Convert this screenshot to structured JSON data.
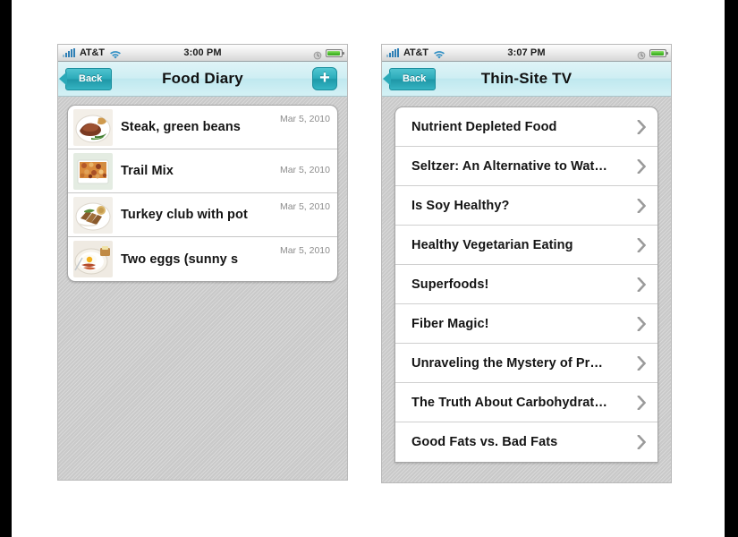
{
  "layout": {
    "background": "#ffffff",
    "letterbox_color": "#000000"
  },
  "phones": [
    {
      "id": "food-diary",
      "status_bar": {
        "carrier": "AT&T",
        "time": "3:00 PM",
        "signal_icon": "signal-bars-icon",
        "wifi_icon": "wifi-icon",
        "alarm_icon": "alarm-clock-icon",
        "battery_icon": "battery-icon"
      },
      "nav": {
        "back_label": "Back",
        "title": "Food Diary",
        "add_label": "+",
        "accent": "#2aa9b8",
        "bar_background": "#cfeef3"
      },
      "rows": [
        {
          "title": "Steak, green beans",
          "date": "Mar 5, 2010",
          "thumb": "steak-green-beans-thumbnail"
        },
        {
          "title": "Trail Mix",
          "date": "Mar 5, 2010",
          "thumb": "trail-mix-thumbnail"
        },
        {
          "title": "Turkey club with pot",
          "date": "Mar 5, 2010",
          "thumb": "turkey-club-thumbnail"
        },
        {
          "title": "Two eggs (sunny s",
          "date": "Mar 5, 2010",
          "thumb": "two-eggs-thumbnail"
        }
      ]
    },
    {
      "id": "thin-site-tv",
      "status_bar": {
        "carrier": "AT&T",
        "time": "3:07 PM",
        "signal_icon": "signal-bars-icon",
        "wifi_icon": "wifi-icon",
        "alarm_icon": "alarm-clock-icon",
        "battery_icon": "battery-icon"
      },
      "nav": {
        "back_label": "Back",
        "title": "Thin-Site TV",
        "accent": "#2aa9b8",
        "bar_background": "#cfeef3"
      },
      "rows": [
        {
          "title": "Nutrient Depleted Food"
        },
        {
          "title": "Seltzer: An Alternative to Wat…"
        },
        {
          "title": "Is Soy Healthy?"
        },
        {
          "title": "Healthy Vegetarian Eating"
        },
        {
          "title": "Superfoods!"
        },
        {
          "title": "Fiber Magic!"
        },
        {
          "title": "Unraveling the Mystery of Pr…"
        },
        {
          "title": "The Truth About Carbohydrat…"
        },
        {
          "title": "Good Fats vs. Bad Fats"
        }
      ]
    }
  ]
}
